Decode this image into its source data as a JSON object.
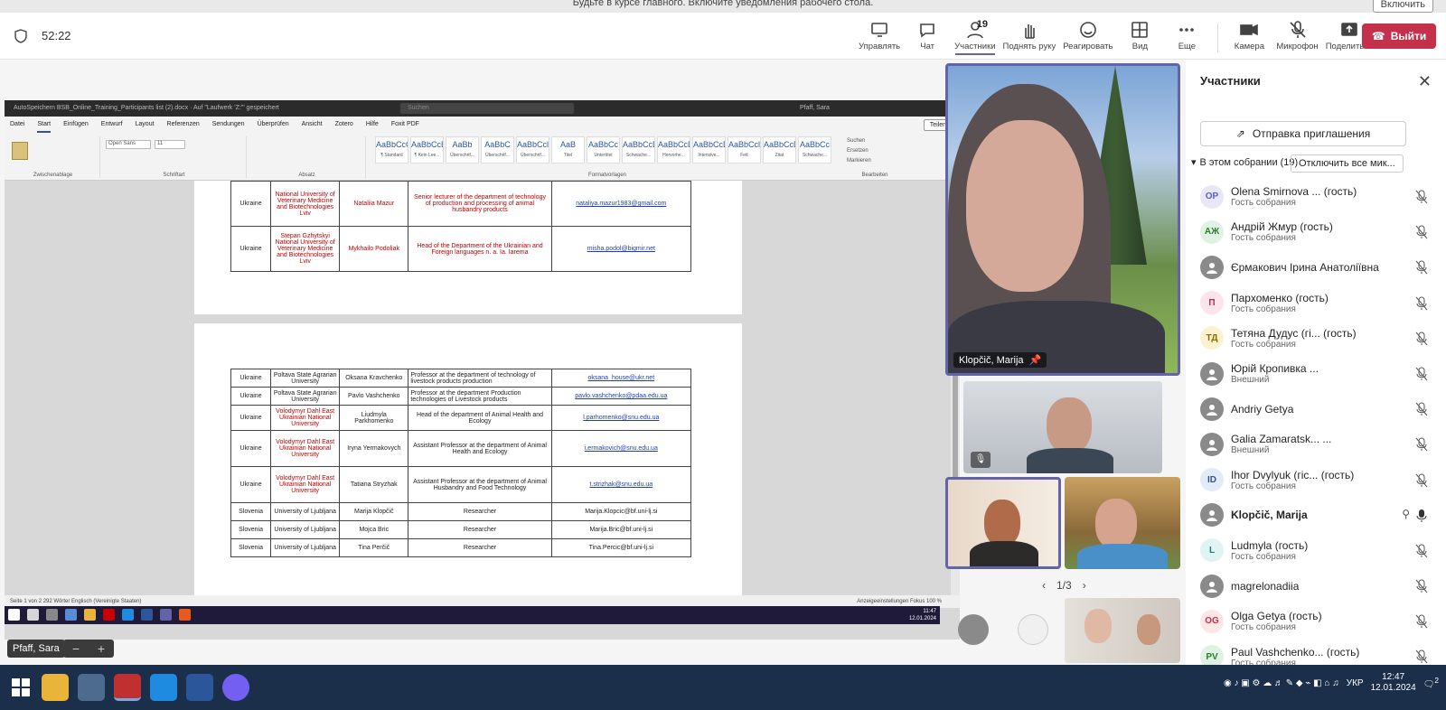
{
  "banner": {
    "text": "Будьте в курсе главного. Включите уведомления рабочего стола.",
    "button": "Включить"
  },
  "header": {
    "timer": "52:22",
    "tools": [
      {
        "id": "share-tray",
        "label": "Управлять"
      },
      {
        "id": "chat",
        "label": "Чат"
      },
      {
        "id": "people",
        "label": "Участники",
        "count": "19"
      },
      {
        "id": "raise",
        "label": "Поднять руку"
      },
      {
        "id": "react",
        "label": "Реагировать"
      },
      {
        "id": "view",
        "label": "Вид"
      },
      {
        "id": "more",
        "label": "Еще"
      }
    ],
    "tools2": [
      {
        "id": "camera",
        "label": "Камера"
      },
      {
        "id": "mic",
        "label": "Микрофон"
      },
      {
        "id": "present",
        "label": "Поделиться"
      }
    ],
    "leave": "Выйти"
  },
  "doc": {
    "title": "AutoSpeichern   BSB_Online_Training_Participants list (2).docx · Auf \"Laufwerk 'Z:'\" gespeichert",
    "search": "Suchen",
    "user": "Pfaff, Sara",
    "menus": [
      "Datei",
      "Start",
      "Einfügen",
      "Entwurf",
      "Layout",
      "Referenzen",
      "Sendungen",
      "Überprüfen",
      "Ansicht",
      "Zotero",
      "Hilfe",
      "Foxit PDF"
    ],
    "share": "Teilen",
    "groups": [
      "Zwischenablage",
      "Schriftart",
      "Absatz",
      "Formatvorlagen",
      "Bearbeiten"
    ],
    "styles": [
      [
        "AaBbCcC",
        "¶ Standard"
      ],
      [
        "AaBbCcE",
        "¶ Kein Lee..."
      ],
      [
        "AaBb",
        "Überschrif..."
      ],
      [
        "AaBbC",
        "Überschrif..."
      ],
      [
        "AaBbCcl",
        "Überschrif..."
      ],
      [
        "AaB",
        "Titel"
      ],
      [
        "AaBbCc",
        "Untertitel"
      ],
      [
        "AaBbCcDc",
        "Schwache..."
      ],
      [
        "AaBbCcD",
        "Hervorhe..."
      ],
      [
        "AaBbCcD",
        "Intensive..."
      ],
      [
        "AaBbCcl",
        "Fett"
      ],
      [
        "AaBbCcD",
        "Zitat"
      ],
      [
        "AaBbCc",
        "Schwache..."
      ]
    ],
    "edit": [
      "Suchen",
      "Ersetzen",
      "Markieren"
    ],
    "font": "Open Sans",
    "size": "11",
    "table1": [
      [
        "Ukraine",
        "National University of Veterinary Medicine and Biotechnologies Lviv",
        "Nataliia Mazur",
        "Senior lecturer of the department of technology of production and processing of animal husbandry products",
        "nataliya.mazur1983@gmail.com"
      ],
      [
        "Ukraine",
        "Stepan Gzhytskyi National University of Veterinary Medicine and Biotechnologies Lviv",
        "Mykhailo Podoliak",
        "Head of the Department of the Ukrainian and Foreign languages n. a. Ia. Iarema",
        "misha.podol@bigmir.net"
      ]
    ],
    "table2": [
      [
        "Ukraine",
        "Poltava State Agrarian University",
        "Oksana Kravchenko",
        "Professor at the department of technology of livestock products production",
        "oksana_house@ukr.net"
      ],
      [
        "Ukraine",
        "Poltava State Agrarian University",
        "Pavlo Vashchenko",
        "Professor at the department Production technologies of Livestock products",
        "pavlo.vashchenko@pdaa.edu.ua"
      ],
      [
        "Ukraine",
        "Volodymyr Dahl East Ukrainian National University",
        "Liudmyla Parkhomenko",
        "Head of the department of Animal Health and Ecology",
        "l.parhomenko@snu.edu.ua"
      ],
      [
        "Ukraine",
        "Volodymyr Dahl East Ukrainian National University",
        "Iryna Yermakovych",
        "Assistant Professor at the department of Animal Health and Ecology",
        "i.ermakovich@snu.edu.ua"
      ],
      [
        "Ukraine",
        "Volodymyr Dahl East Ukrainian National University",
        "Tatiana Stryzhak",
        "Assistant Professor at the department of Animal Husbandry and Food Technology",
        "t.strizhak@snu.edu.ua"
      ],
      [
        "Slovenia",
        "University of Ljubljana",
        "Marija Klopčič",
        "Researcher",
        "Marija.Klopcic@bf.uni-lj.si"
      ],
      [
        "Slovenia",
        "University of Ljubljana",
        "Mojca Bric",
        "Researcher",
        "Marija.Bric@bf.uni-lj.si"
      ],
      [
        "Slovenia",
        "University of Ljubljana",
        "Tina Perčič",
        "Researcher",
        "Tina.Percic@bf.uni-lj.si"
      ]
    ],
    "status": "Seite 1 von 2    292 Wörter        Englisch (Vereinigte Staaten)",
    "statusRight": "Anzeigeeinstellungen    Fokus                    100 %",
    "clock": [
      "11:47",
      "12.01.2024"
    ]
  },
  "stage": {
    "speaker": "Klopčič, Marija",
    "chip": "Pfaff, Sara",
    "pager": "1/3"
  },
  "panel": {
    "title": "Участники",
    "invite": "Отправка приглашения",
    "section": "В этом собрании (19)",
    "muteAll": "Отключить все мик...",
    "people": [
      {
        "init": "OP",
        "name": "Olena Smirnova ... (гость)",
        "sub": "Гость собрания",
        "bg": "#e8e6f7",
        "fg": "#5b5fc7",
        "pinned": false
      },
      {
        "init": "АЖ",
        "name": "Андрій Жмур (гость)",
        "sub": "Гость собрания",
        "bg": "#e0f2e4",
        "fg": "#2e7d32",
        "pinned": false
      },
      {
        "init": "",
        "name": "Єрмакович Ірина Анатоліївна",
        "sub": "",
        "bg": "#8a8a8a",
        "fg": "#fff",
        "pinned": false
      },
      {
        "init": "П",
        "name": "Пархоменко (гость)",
        "sub": "Гость собрания",
        "bg": "#fbe4ec",
        "fg": "#b3265a",
        "pinned": false
      },
      {
        "init": "ТД",
        "name": "Тетяна Дудус (гі... (гость)",
        "sub": "Гость собрания",
        "bg": "#fdf2d0",
        "fg": "#8a6d00",
        "pinned": false
      },
      {
        "init": "",
        "name": "Юрій Кропивка ...",
        "sub": "Внешний",
        "bg": "#8a8a8a",
        "fg": "#fff",
        "pinned": false
      },
      {
        "init": "",
        "name": "Andriy Getya",
        "sub": "",
        "bg": "#8a8a8a",
        "fg": "#fff",
        "pinned": false
      },
      {
        "init": "",
        "name": "Galia Zamaratsk... ...",
        "sub": "Внешний",
        "bg": "#8a8a8a",
        "fg": "#fff",
        "pinned": false
      },
      {
        "init": "ID",
        "name": "Ihor Dvylyuk (гіс... (гость)",
        "sub": "Гость собрания",
        "bg": "#e3eaf8",
        "fg": "#2f5597",
        "pinned": false
      },
      {
        "init": "",
        "name": "Klopčič, Marija",
        "sub": "",
        "bg": "#8a8a8a",
        "fg": "#fff",
        "pinned": true
      },
      {
        "init": "L",
        "name": "Ludmyla (гость)",
        "sub": "Гость собрания",
        "bg": "#e0f4f4",
        "fg": "#1b7a7a",
        "pinned": false
      },
      {
        "init": "",
        "name": "magrelonadiia",
        "sub": "",
        "bg": "#8a8a8a",
        "fg": "#fff",
        "pinned": false
      },
      {
        "init": "OG",
        "name": "Olga Getya (гость)",
        "sub": "Гость собрания",
        "bg": "#fde6e6",
        "fg": "#c4314b",
        "pinned": false
      },
      {
        "init": "PV",
        "name": "Paul Vashchenko... (гость)",
        "sub": "Гость собрания",
        "bg": "#e0f2e4",
        "fg": "#2e7d32",
        "pinned": false
      }
    ]
  },
  "taskbar": {
    "lang": "УКР",
    "time": "12:47",
    "date": "12.01.2024",
    "badge": "2"
  }
}
